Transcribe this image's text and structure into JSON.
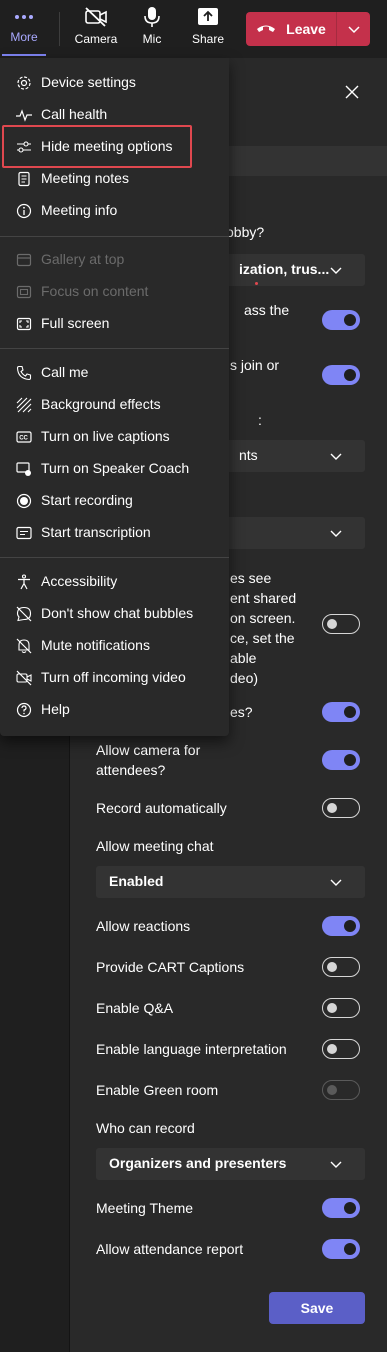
{
  "toolbar": {
    "more_label": "More",
    "camera_label": "Camera",
    "mic_label": "Mic",
    "share_label": "Share",
    "leave_label": "Leave"
  },
  "menu": {
    "group1": [
      {
        "label": "Device settings",
        "icon": "gear-icon",
        "enabled": true
      },
      {
        "label": "Call health",
        "icon": "pulse-icon",
        "enabled": true
      },
      {
        "label": "Hide meeting options",
        "icon": "sliders-icon",
        "enabled": true,
        "highlighted": true
      },
      {
        "label": "Meeting notes",
        "icon": "notes-icon",
        "enabled": true
      },
      {
        "label": "Meeting info",
        "icon": "info-icon",
        "enabled": true
      }
    ],
    "group2": [
      {
        "label": "Gallery at top",
        "icon": "gallery-icon",
        "enabled": false
      },
      {
        "label": "Focus on content",
        "icon": "focus-icon",
        "enabled": false
      },
      {
        "label": "Full screen",
        "icon": "fullscreen-icon",
        "enabled": true
      }
    ],
    "group3": [
      {
        "label": "Call me",
        "icon": "phone-icon",
        "enabled": true
      },
      {
        "label": "Background effects",
        "icon": "background-effects-icon",
        "enabled": true
      },
      {
        "label": "Turn on live captions",
        "icon": "captions-icon",
        "enabled": true
      },
      {
        "label": "Turn on Speaker Coach",
        "icon": "speaker-coach-icon",
        "enabled": true
      },
      {
        "label": "Start recording",
        "icon": "record-icon",
        "enabled": true
      },
      {
        "label": "Start transcription",
        "icon": "transcription-icon",
        "enabled": true
      }
    ],
    "group4": [
      {
        "label": "Accessibility",
        "icon": "accessibility-icon",
        "enabled": true
      },
      {
        "label": "Don't show chat bubbles",
        "icon": "chat-off-icon",
        "enabled": true
      },
      {
        "label": "Mute notifications",
        "icon": "bell-off-icon",
        "enabled": true
      },
      {
        "label": "Turn off incoming video",
        "icon": "video-off-icon",
        "enabled": true
      },
      {
        "label": "Help",
        "icon": "help-icon",
        "enabled": true
      }
    ]
  },
  "panel": {
    "partial": {
      "lobby_q": "obby?",
      "lobby_dd": "ization, trus...",
      "bypass": "ass the",
      "join_or": "s join or",
      "colon": ":",
      "presenters_dd": "nts",
      "see1": "es see",
      "see2": "ent shared",
      "see3": "on screen.",
      "see4": "ce, set the",
      "see5": "able",
      "see6": "deo)",
      "es": "es?"
    },
    "allow_camera": "Allow camera for attendees?",
    "record_auto": "Record automatically",
    "allow_chat": "Allow meeting chat",
    "chat_value": "Enabled",
    "allow_reactions": "Allow reactions",
    "cart": "Provide CART Captions",
    "qa": "Enable Q&A",
    "lang": "Enable language interpretation",
    "green": "Enable Green room",
    "who_record": "Who can record",
    "record_value": "Organizers and presenters",
    "theme": "Meeting Theme",
    "attendance": "Allow attendance report",
    "save": "Save"
  },
  "colors": {
    "accent": "#7f85f5",
    "leave_red": "#c4314b",
    "save_purple": "#5b5fc7",
    "highlight_red": "#e0484f"
  }
}
